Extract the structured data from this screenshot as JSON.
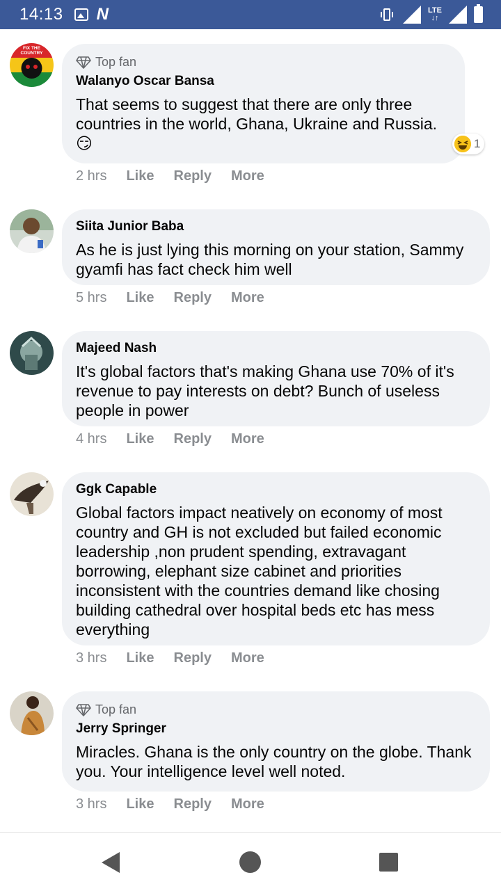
{
  "status": {
    "time": "14:13",
    "network": "LTE"
  },
  "colors": {
    "statusbar": "#3b5998",
    "bubble": "#f0f2f5",
    "meta": "#8a8d91"
  },
  "comments": [
    {
      "badge": "Top fan",
      "author": "Walanyo Oscar Bansa",
      "text": "That seems to suggest that there are only three countries in the world, Ghana, Ukraine and Russia. 😏",
      "time": "2 hrs",
      "like": "Like",
      "reply": "Reply",
      "more": "More",
      "reaction_count": "1",
      "avatar_text": "FIX THE COUNTRY"
    },
    {
      "author": "Siita Junior Baba",
      "text": "As he is just lying this morning on your station, Sammy gyamfi has fact check him well",
      "time": "5 hrs",
      "like": "Like",
      "reply": "Reply",
      "more": "More"
    },
    {
      "author": "Majeed Nash",
      "text": "It's global factors that's making Ghana use 70% of it's revenue to pay interests on debt? Bunch of useless people in power",
      "time": "4 hrs",
      "like": "Like",
      "reply": "Reply",
      "more": "More"
    },
    {
      "author": "Ggk Capable",
      "text": "Global factors impact neatively on economy of most country and GH is not excluded but failed economic leadership ,non prudent spending, extravagant borrowing, elephant size cabinet and priorities inconsistent with the countries demand like chosing building cathedral over hospital beds etc has mess everything",
      "time": "3 hrs",
      "like": "Like",
      "reply": "Reply",
      "more": "More"
    },
    {
      "badge": "Top fan",
      "author": "Jerry Springer",
      "text": "Miracles. Ghana is the only country on the globe. Thank you. Your intelligence level well noted.",
      "time": "3 hrs",
      "like": "Like",
      "reply": "Reply",
      "more": "More"
    }
  ]
}
